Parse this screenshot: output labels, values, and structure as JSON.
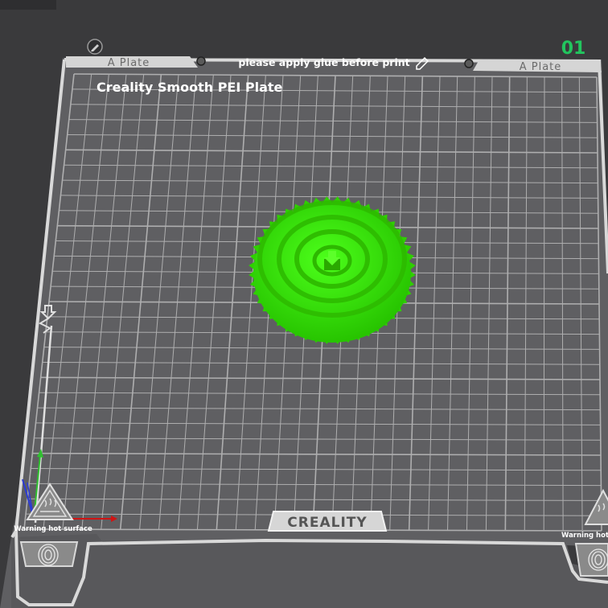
{
  "plate": {
    "number": "01",
    "tab_left": "A Plate",
    "tab_right": "A Plate",
    "notice": "please apply glue before print",
    "plate_name": "Creality Smooth PEI Plate",
    "brand": "CREALITY",
    "warning_left": "Warning hot surface",
    "warning_right": "Warning hot surface"
  },
  "colors": {
    "background": "#3a3a3c",
    "plate": "#636366",
    "grid": "#c8c8c8",
    "model": "#33e000",
    "plate_number": "#22c55e",
    "axis_x": "#d01414",
    "axis_y": "#2fbf2f",
    "axis_z": "#2b3bd6"
  },
  "icons": {
    "edit": "pencil-icon",
    "heat_warning": "hot-surface-warning-icon",
    "fingerprint": "fingerprint-icon",
    "origin_marker": "origin-arrow-icon"
  }
}
